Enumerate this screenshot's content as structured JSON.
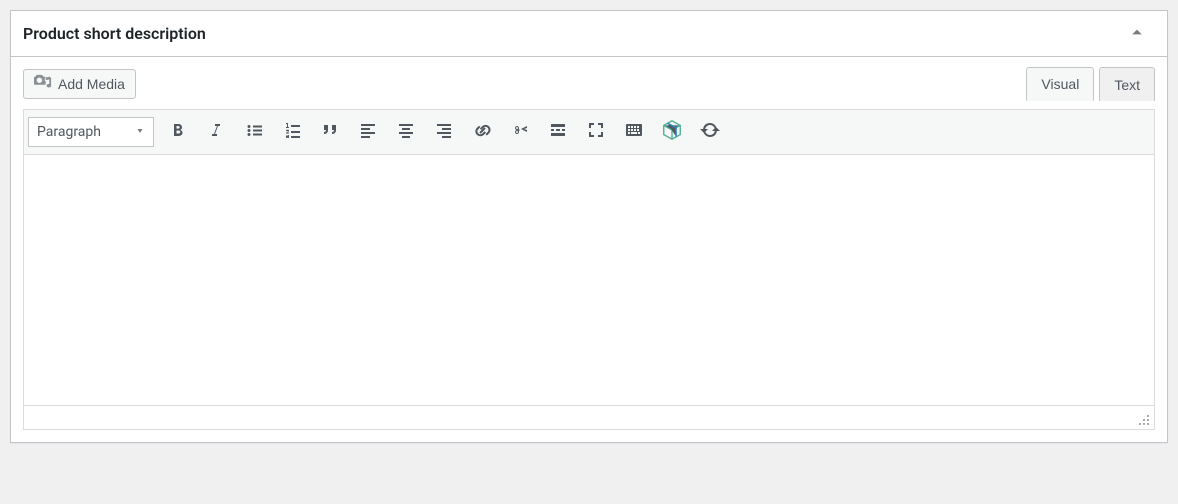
{
  "panel": {
    "title": "Product short description"
  },
  "media": {
    "add_media_label": "Add Media"
  },
  "tabs": {
    "visual": "Visual",
    "text": "Text",
    "active": "visual"
  },
  "toolbar": {
    "format_selector": "Paragraph"
  },
  "editor": {
    "content": "",
    "path": ""
  }
}
